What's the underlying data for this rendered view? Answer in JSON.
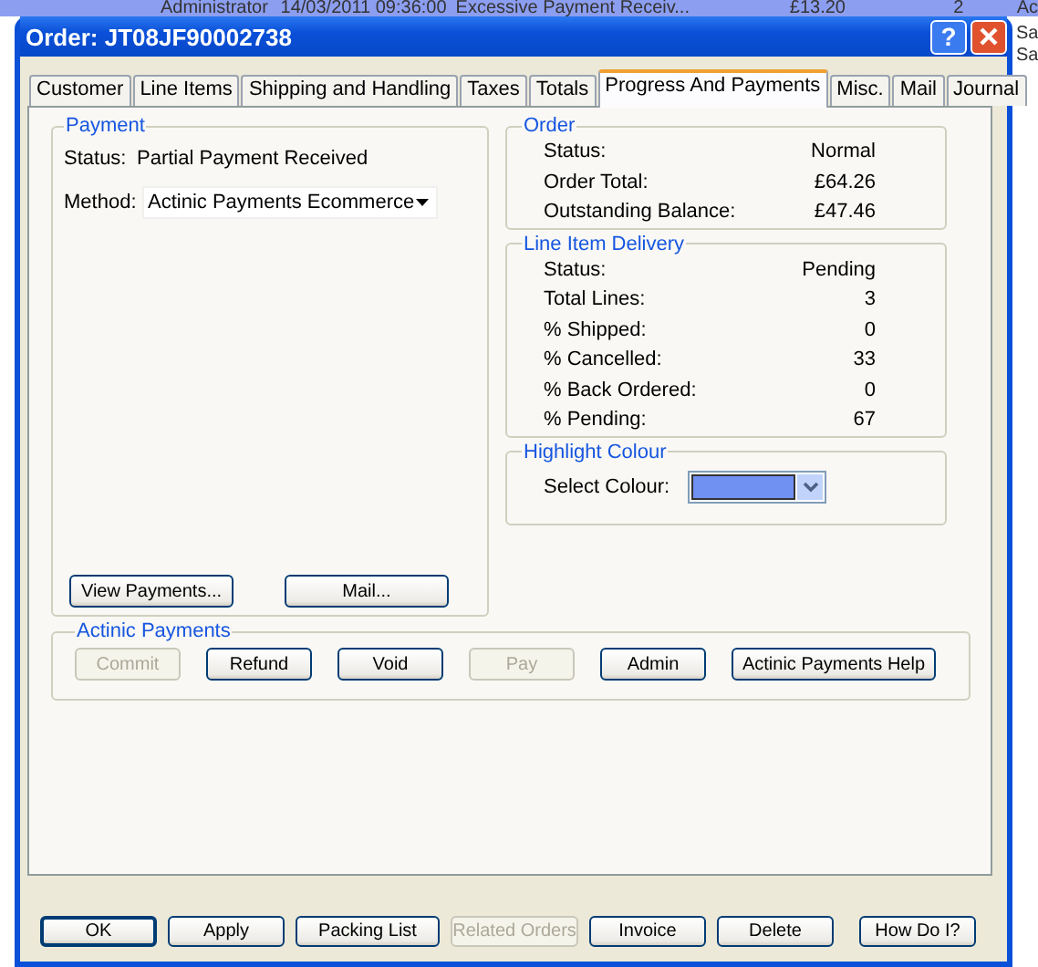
{
  "background_list": {
    "row": {
      "selected": true,
      "cells": [
        "Administrator",
        "14/03/2011 09:36:00",
        "Excessive Payment Receiv...",
        "£13.20",
        "2",
        "Ac"
      ]
    },
    "right_column": [
      "Sa",
      "Sa"
    ]
  },
  "window": {
    "title": "Order: JT08JF90002738",
    "help": "?"
  },
  "tabs": [
    {
      "label": "Customer",
      "selected": false
    },
    {
      "label": "Line Items",
      "selected": false
    },
    {
      "label": "Shipping and Handling",
      "selected": false
    },
    {
      "label": "Taxes",
      "selected": false
    },
    {
      "label": "Totals",
      "selected": false
    },
    {
      "label": "Progress And Payments",
      "selected": true
    },
    {
      "label": "Misc.",
      "selected": false
    },
    {
      "label": "Mail",
      "selected": false
    },
    {
      "label": "Journal",
      "selected": false
    }
  ],
  "payment": {
    "title": "Payment",
    "status_label": "Status:",
    "status_value": "Partial Payment Received",
    "method_label": "Method:",
    "method_value": "Actinic Payments Ecommerce",
    "buttons": [
      {
        "label": "View Payments...",
        "disabled": false
      },
      {
        "label": "Mail...",
        "disabled": false
      }
    ]
  },
  "order": {
    "title": "Order",
    "rows": [
      {
        "label": "Status:",
        "value": "Normal"
      },
      {
        "label": "Order Total:",
        "value": "£64.26"
      },
      {
        "label": "Outstanding Balance:",
        "value": "£47.46"
      }
    ]
  },
  "delivery": {
    "title": "Line Item Delivery",
    "rows": [
      {
        "label": "Status:",
        "value": "Pending"
      },
      {
        "label": "Total Lines:",
        "value": "3"
      },
      {
        "label": "% Shipped:",
        "value": "0"
      },
      {
        "label": "% Cancelled:",
        "value": "33"
      },
      {
        "label": "% Back Ordered:",
        "value": "0"
      },
      {
        "label": "% Pending:",
        "value": "67"
      }
    ]
  },
  "highlight": {
    "title": "Highlight Colour",
    "label": "Select Colour:",
    "color": "#7090f2"
  },
  "actinic": {
    "title": "Actinic Payments",
    "buttons": [
      {
        "label": "Commit",
        "disabled": true
      },
      {
        "label": "Refund",
        "disabled": false
      },
      {
        "label": "Void",
        "disabled": false
      },
      {
        "label": "Pay",
        "disabled": true
      },
      {
        "label": "Admin",
        "disabled": false
      },
      {
        "label": "Actinic Payments Help",
        "disabled": false
      }
    ]
  },
  "footer": [
    {
      "label": "OK",
      "disabled": false
    },
    {
      "label": "Apply",
      "disabled": false
    },
    {
      "label": "Packing List",
      "disabled": false
    },
    {
      "label": "Related Orders",
      "disabled": true
    },
    {
      "label": "Invoice",
      "disabled": false
    },
    {
      "label": "Delete",
      "disabled": false
    },
    {
      "label": "How Do I?",
      "disabled": false
    }
  ]
}
